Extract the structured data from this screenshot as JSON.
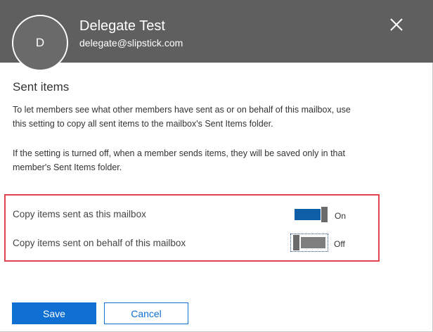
{
  "header": {
    "avatar_initial": "D",
    "display_name": "Delegate Test",
    "email": "delegate@slipstick.com",
    "close_icon": "close-icon"
  },
  "section": {
    "title": "Sent items",
    "description_1": "To let members see what other members have sent as or on behalf of this mailbox, use this setting to copy all sent items to the mailbox's Sent Items folder.",
    "description_2": "If the setting is turned off, when a member sends items, they will be saved only in that member's Sent Items folder."
  },
  "settings": [
    {
      "label": "Copy items sent as this mailbox",
      "state": "On",
      "enabled": true
    },
    {
      "label": "Copy items sent on behalf of this mailbox",
      "state": "Off",
      "enabled": false
    }
  ],
  "footer": {
    "save_label": "Save",
    "cancel_label": "Cancel"
  },
  "colors": {
    "header_bg": "#5f5f5f",
    "toggle_on": "#0d5ea6",
    "toggle_off": "#7e7e7e",
    "primary": "#0f6fd2",
    "highlight_border": "#e0454f"
  }
}
